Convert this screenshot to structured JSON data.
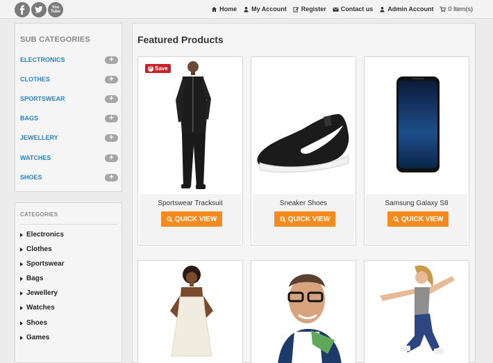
{
  "social": {
    "youtube_label": "You Tube"
  },
  "nav": {
    "home": "Home",
    "my_account": "My Account",
    "register": "Register",
    "contact": "Contact us",
    "admin": "Admin Account",
    "cart": "0 Item(s)"
  },
  "sub_categories": {
    "title": "SUB CATEGORIES",
    "items": [
      "ELECTRONICS",
      "CLOTHES",
      "SPORTSWEAR",
      "BAGS",
      "JEWELLERY",
      "WATCHES",
      "SHOES"
    ],
    "expand_symbol": "+"
  },
  "categories": {
    "title": "CATEGORIES",
    "items": [
      "Electronics",
      "Clothes",
      "Sportswear",
      "Bags",
      "Jewellery",
      "Watches",
      "Shoes",
      "Games"
    ]
  },
  "main": {
    "heading": "Featured Products",
    "save_label": "Save",
    "quick_view_label": "QUICK VIEW",
    "products": [
      {
        "name": "Sportswear Tracksuit"
      },
      {
        "name": "Sneaker Shoes"
      },
      {
        "name": "Samsung Galaxy S8"
      }
    ]
  },
  "colors": {
    "accent_orange": "#f58b1f",
    "link_blue": "#2a83c4",
    "pinterest_red": "#cb2027"
  }
}
